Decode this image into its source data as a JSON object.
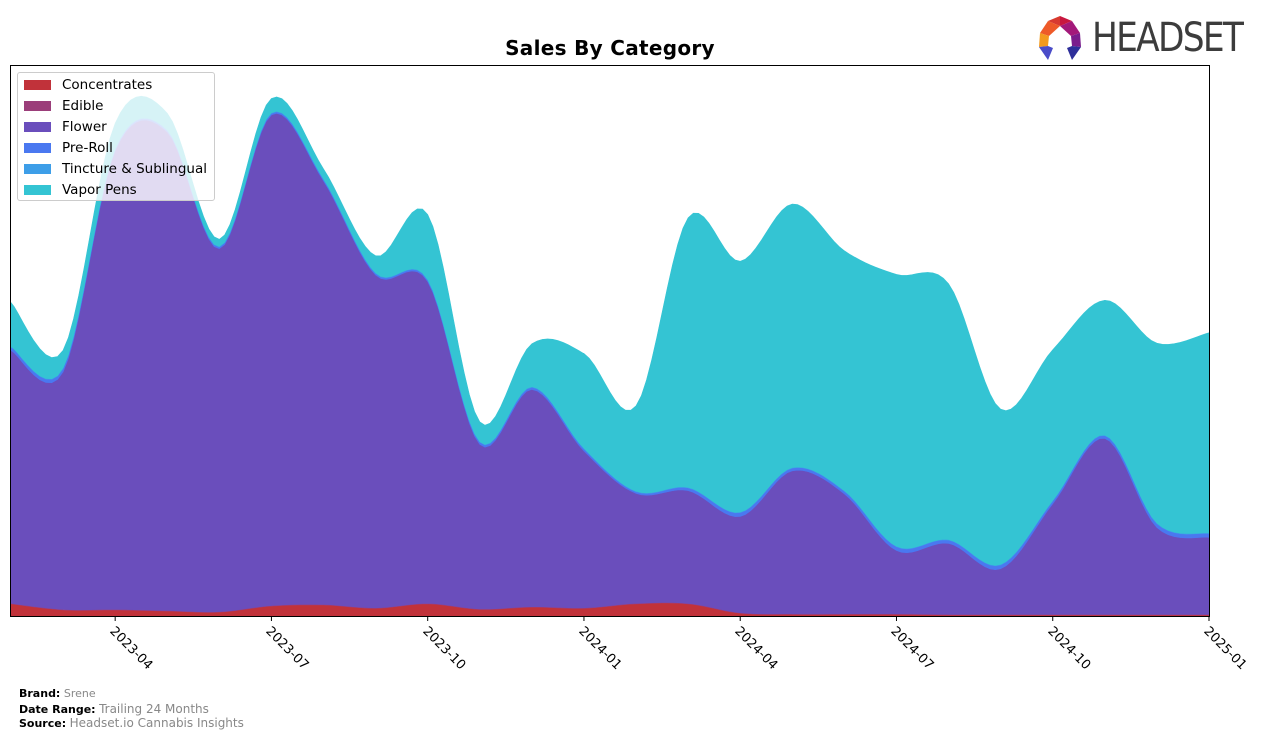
{
  "header": {
    "logo_text": "HEADSET"
  },
  "footer": {
    "brand_label": "Brand:",
    "brand_value": "Srene",
    "date_range_label": "Date Range:",
    "date_range_value": "Trailing 24 Months",
    "source_label": "Source:",
    "source_value": "Headset.io Cannabis Insights"
  },
  "chart_data": {
    "type": "area",
    "stacked": true,
    "smoothed": true,
    "title": "Sales By Category",
    "xlabel": "",
    "ylabel": "",
    "y_units": "relative (no y-axis shown; 100 = top of plot)",
    "ylim": [
      0,
      100
    ],
    "grid": false,
    "legend_position": "top-left",
    "x": [
      "2023-02",
      "2023-03",
      "2023-04",
      "2023-05",
      "2023-06",
      "2023-07",
      "2023-08",
      "2023-09",
      "2023-10",
      "2023-11",
      "2023-12",
      "2024-01",
      "2024-02",
      "2024-03",
      "2024-04",
      "2024-05",
      "2024-06",
      "2024-07",
      "2024-08",
      "2024-09",
      "2024-10",
      "2024-11",
      "2024-12",
      "2025-01"
    ],
    "x_tick_labels": [
      "2023-04",
      "2023-07",
      "2023-10",
      "2024-01",
      "2024-04",
      "2024-07",
      "2024-10",
      "2025-01"
    ],
    "series": [
      {
        "name": "Concentrates",
        "color": "#c1323a",
        "values": [
          2.2,
          1.1,
          1.1,
          0.9,
          0.7,
          1.8,
          2.0,
          1.4,
          2.2,
          1.2,
          1.6,
          1.4,
          2.2,
          2.2,
          0.5,
          0.3,
          0.3,
          0.3,
          0.2,
          0.2,
          0.2,
          0.2,
          0.2,
          0.2
        ]
      },
      {
        "name": "Edible",
        "color": "#9b3e7a",
        "values": [
          0.1,
          0.1,
          0.1,
          0.1,
          0.1,
          0.1,
          0.1,
          0.1,
          0.1,
          0.1,
          0.1,
          0.1,
          0.1,
          0.1,
          0.1,
          0.1,
          0.1,
          0.1,
          0.1,
          0.1,
          0.1,
          0.1,
          0.1,
          0.1
        ]
      },
      {
        "name": "Flower",
        "color": "#6a4ebc",
        "values": [
          46.0,
          43.2,
          83.4,
          87.0,
          66.0,
          89.2,
          77.0,
          60.5,
          58.5,
          29.9,
          39.5,
          28.5,
          20.0,
          20.5,
          17.5,
          26.0,
          21.8,
          11.5,
          12.9,
          8.3,
          20.1,
          32.0,
          15.8,
          14.0
        ]
      },
      {
        "name": "Pre-Roll",
        "color": "#4a78f0",
        "values": [
          0.6,
          0.6,
          0.3,
          0.3,
          0.3,
          0.3,
          0.3,
          0.3,
          0.3,
          0.4,
          0.4,
          0.4,
          0.3,
          0.5,
          0.7,
          0.5,
          0.5,
          0.7,
          0.6,
          0.7,
          0.5,
          0.5,
          0.7,
          0.7
        ]
      },
      {
        "name": "Tincture & Sublingual",
        "color": "#3d9ee8",
        "values": [
          0.1,
          0.1,
          0.1,
          0.1,
          0.1,
          0.1,
          0.1,
          0.1,
          0.1,
          0.1,
          0.1,
          0.1,
          0.1,
          0.1,
          0.1,
          0.1,
          0.1,
          0.1,
          0.1,
          0.1,
          0.1,
          0.1,
          0.1,
          0.1
        ]
      },
      {
        "name": "Vapor Pens",
        "color": "#34c4d3",
        "values": [
          8.0,
          3.2,
          4.6,
          3.0,
          1.3,
          2.6,
          1.8,
          3.1,
          11.8,
          3.6,
          7.8,
          17.2,
          15.5,
          49.0,
          45.6,
          47.9,
          43.6,
          49.4,
          46.5,
          28.2,
          27.4,
          24.5,
          32.7,
          36.4
        ]
      }
    ]
  }
}
